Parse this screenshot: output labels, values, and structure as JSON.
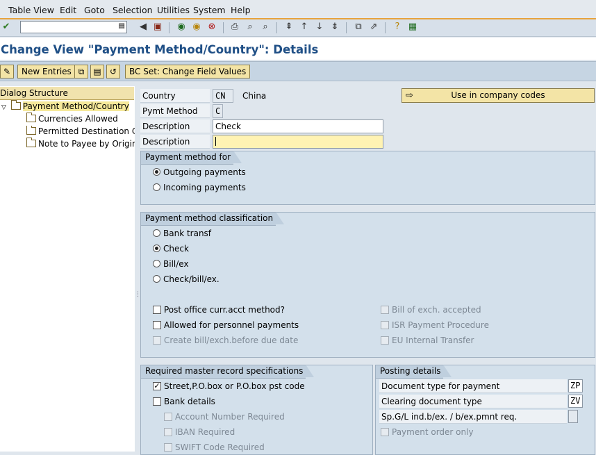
{
  "menu": {
    "items": [
      "Table View",
      "Edit",
      "Goto",
      "Selection",
      "Utilities",
      "System",
      "Help"
    ]
  },
  "toolbar": {
    "command_field_value": "",
    "icons": [
      "enter-icon",
      "back-icon",
      "save-icon",
      "back-arrow-icon",
      "exit-icon",
      "cancel-icon",
      "print-icon",
      "find-icon",
      "find-next-icon",
      "first-page-icon",
      "prev-page-icon",
      "next-page-icon",
      "last-page-icon",
      "create-session-icon",
      "shortcut-icon",
      "help-icon",
      "customize-layout-icon"
    ]
  },
  "title": "Change View \"Payment Method/Country\": Details",
  "app_toolbar": {
    "new_entries": "New Entries",
    "bc_set": "BC Set: Change Field Values"
  },
  "tree": {
    "header": "Dialog Structure",
    "root": "Payment Method/Country",
    "children": [
      "Currencies Allowed",
      "Permitted Destination Cou",
      "Note to Payee by Origin"
    ]
  },
  "header_fields": {
    "country_label": "Country",
    "country_value": "CN",
    "country_name": "China",
    "pymt_method_label": "Pymt Method",
    "pymt_method_value": "C",
    "description_label": "Description",
    "description_value": "Check",
    "description2_label": "Description",
    "description2_value": "",
    "use_in_company_codes": "Use in company codes"
  },
  "payment_method_for": {
    "title": "Payment method for",
    "options": [
      "Outgoing payments",
      "Incoming payments"
    ],
    "selected": "Outgoing payments"
  },
  "classification": {
    "title": "Payment method classification",
    "radios": [
      "Bank transf",
      "Check",
      "Bill/ex",
      "Check/bill/ex."
    ],
    "selected": "Check",
    "checkboxes_left": [
      "Post office curr.acct method?",
      "Allowed for personnel payments",
      "Create bill/exch.before due date"
    ],
    "checkboxes_right": [
      "Bill of exch. accepted",
      "ISR Payment Procedure",
      "EU Internal Transfer"
    ]
  },
  "master_record": {
    "title": "Required master record specifications",
    "street": "Street,P.O.box or P.O.box pst code",
    "street_checked": true,
    "bank_details": "Bank details",
    "bank_checked": false,
    "account_number": "Account Number Required",
    "iban": "IBAN Required",
    "swift": "SWIFT Code Required"
  },
  "posting": {
    "title": "Posting details",
    "doc_type_label": "Document type for payment",
    "doc_type_value": "ZP",
    "clearing_label": "Clearing document type",
    "clearing_value": "ZV",
    "spgl_label": "Sp.G/L ind.b/ex. / b/ex.pmnt req.",
    "spgl_value": "",
    "payment_order_only": "Payment order only"
  }
}
